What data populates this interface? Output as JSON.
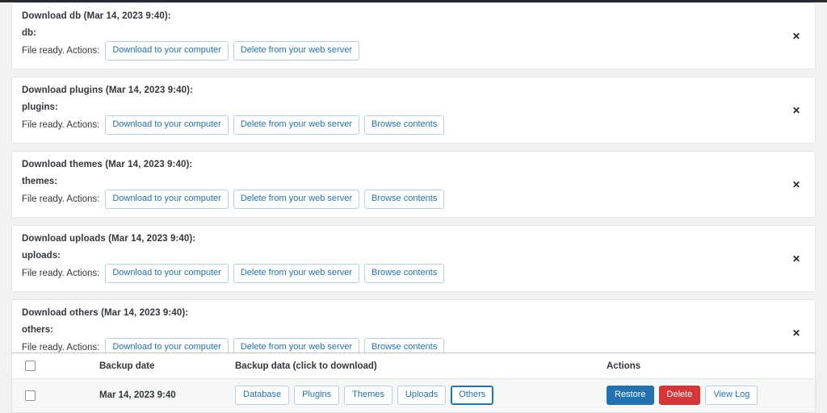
{
  "top_strip": {
    "color": "#23282d"
  },
  "colors": {
    "page_background": "#f1f1f1",
    "panel_background": "#ffffff",
    "panel_border": "#e2e4e7",
    "link_blue": "#2271b1",
    "outline_border": "#b4d0e7",
    "danger_red": "#d63638",
    "text": "#32373c",
    "row_alt": "#f6f7f7"
  },
  "download_panels": [
    {
      "title": "Download db (Mar 14, 2023 9:40):",
      "entity": "db:",
      "status": "File ready. Actions:",
      "buttons": [
        "Download to your computer",
        "Delete from your web server"
      ],
      "close_label": "✕"
    },
    {
      "title": "Download plugins (Mar 14, 2023 9:40):",
      "entity": "plugins:",
      "status": "File ready. Actions:",
      "buttons": [
        "Download to your computer",
        "Delete from your web server",
        "Browse contents"
      ],
      "close_label": "✕"
    },
    {
      "title": "Download themes (Mar 14, 2023 9:40):",
      "entity": "themes:",
      "status": "File ready. Actions:",
      "buttons": [
        "Download to your computer",
        "Delete from your web server",
        "Browse contents"
      ],
      "close_label": "✕"
    },
    {
      "title": "Download uploads (Mar 14, 2023 9:40):",
      "entity": "uploads:",
      "status": "File ready. Actions:",
      "buttons": [
        "Download to your computer",
        "Delete from your web server",
        "Browse contents"
      ],
      "close_label": "✕"
    },
    {
      "title": "Download others (Mar 14, 2023 9:40):",
      "entity": "others:",
      "status": "File ready. Actions:",
      "buttons": [
        "Download to your computer",
        "Delete from your web server",
        "Browse contents"
      ],
      "close_label": "✕"
    }
  ],
  "backups_table": {
    "headers": {
      "select_all": "",
      "date": "Backup date",
      "data": "Backup data (click to download)",
      "actions": "Actions"
    },
    "rows": [
      {
        "date": "Mar 14, 2023 9:40",
        "data_buttons": [
          {
            "label": "Database",
            "focused": false
          },
          {
            "label": "Plugins",
            "focused": false
          },
          {
            "label": "Themes",
            "focused": false
          },
          {
            "label": "Uploads",
            "focused": false
          },
          {
            "label": "Others",
            "focused": true
          }
        ],
        "actions": {
          "restore": "Restore",
          "delete": "Delete",
          "view_log": "View Log"
        }
      }
    ]
  }
}
